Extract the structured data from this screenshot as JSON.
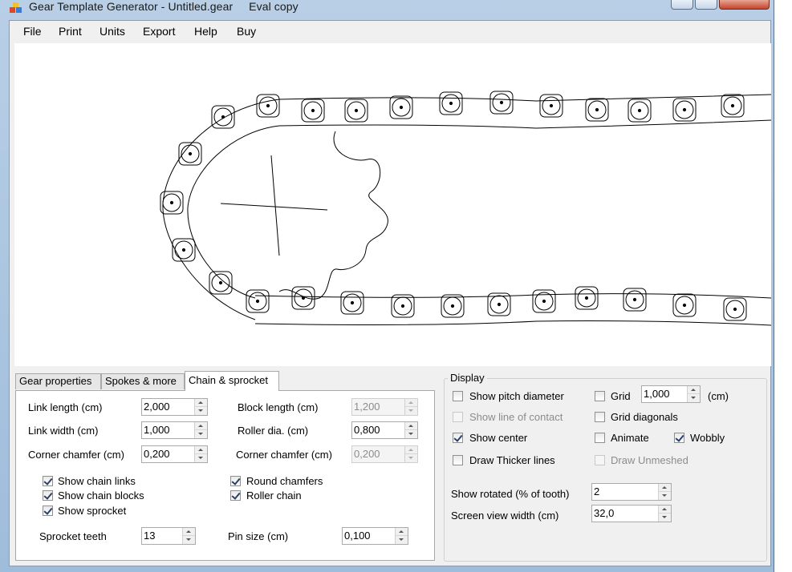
{
  "window": {
    "title": "Gear Template Generator - Untitled.gear     Eval copy"
  },
  "menu": [
    "File",
    "Print",
    "Units",
    "Export",
    "Help",
    "Buy"
  ],
  "tabs": [
    {
      "label": "Gear properties",
      "active": false
    },
    {
      "label": "Spokes & more",
      "active": false
    },
    {
      "label": "Chain & sprocket",
      "active": true
    }
  ],
  "chain": {
    "link_length": {
      "label": "Link length (cm)",
      "value": "2,000"
    },
    "link_width": {
      "label": "Link width (cm)",
      "value": "1,000"
    },
    "corner_chamfer_left": {
      "label": "Corner chamfer (cm)",
      "value": "0,200"
    },
    "block_length": {
      "label": "Block length (cm)",
      "value": "1,200",
      "enabled": false
    },
    "roller_dia": {
      "label": "Roller dia. (cm)",
      "value": "0,800"
    },
    "corner_chamfer_right": {
      "label": "Corner chamfer (cm)",
      "value": "0,200",
      "enabled": false
    },
    "show_chain_links": {
      "label": "Show chain links",
      "checked": true
    },
    "show_chain_blocks": {
      "label": "Show chain blocks",
      "checked": true
    },
    "show_sprocket": {
      "label": "Show sprocket",
      "checked": true
    },
    "round_chamfers": {
      "label": "Round chamfers",
      "checked": true
    },
    "roller_chain": {
      "label": "Roller chain",
      "checked": true
    },
    "sprocket_teeth": {
      "label": "Sprocket teeth",
      "value": "13"
    },
    "pin_size": {
      "label": "Pin size (cm)",
      "value": "0,100"
    }
  },
  "display": {
    "title": "Display",
    "show_pitch_diameter": {
      "label": "Show pitch diameter",
      "checked": false
    },
    "show_line_of_contact": {
      "label": "Show line of contact",
      "checked": false,
      "enabled": false
    },
    "show_center": {
      "label": "Show center",
      "checked": true
    },
    "draw_thicker_lines": {
      "label": "Draw Thicker lines",
      "checked": false
    },
    "grid": {
      "label": "Grid",
      "checked": false,
      "value": "1,000",
      "unit": "(cm)"
    },
    "grid_diagonals": {
      "label": "Grid diagonals",
      "checked": false
    },
    "animate": {
      "label": "Animate",
      "checked": false
    },
    "wobbly": {
      "label": "Wobbly",
      "checked": true
    },
    "draw_unmeshed": {
      "label": "Draw Unmeshed",
      "checked": false,
      "enabled": false
    },
    "show_rotated": {
      "label": "Show rotated (% of tooth)",
      "value": "2"
    },
    "screen_view_width": {
      "label": "Screen view width (cm)",
      "value": "32,0"
    }
  },
  "colors": {
    "window_frame": "#b8cfe6",
    "client_bg": "#f0f0f0",
    "canvas_bg": "#ffffff",
    "check_mark": "#2a3f6b"
  }
}
